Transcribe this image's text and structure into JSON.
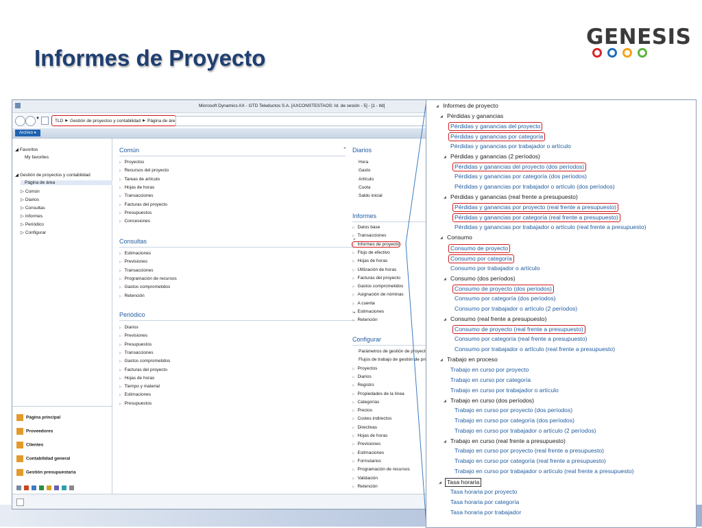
{
  "slide": {
    "title": "Informes de Proyecto",
    "logo_text": "GENESIS",
    "logo_ring_colors": [
      "#d6262b",
      "#1f6fb5",
      "#f3a21a",
      "#5cb33b"
    ]
  },
  "window": {
    "title": "Microsoft Dynamics AX - GTD Teleductos S.A. [AXCONSTESTAOS: Id. de sesión - 5] - [1 - tld]",
    "breadcrumb": [
      "TLD",
      "Gestión de proyectos y contabilidad",
      "Página de área"
    ],
    "archivo_label": "Archivo"
  },
  "left_nav": {
    "favoritos": "Favoritos",
    "my_favorites": "My favorites",
    "module": "Gestión de proyectos y contabilidad",
    "items": [
      "Página de área",
      "Común",
      "Diarios",
      "Consultas",
      "Informes",
      "Periódico",
      "Configurar"
    ],
    "bottom_modules": [
      "Página principal",
      "Proveedores",
      "Clientes",
      "Contabilidad general",
      "Gestión presupuestaria"
    ]
  },
  "groups": {
    "comun": {
      "title": "Común",
      "items": [
        "Proyectos",
        "Recursos del proyecto",
        "Tareas de artículo",
        "Hojas de horas",
        "Transacciones",
        "Facturas del proyecto",
        "Presupuestos",
        "Concesiones"
      ]
    },
    "consultas": {
      "title": "Consultas",
      "items": [
        "Estimaciones",
        "Previsiones",
        "Transacciones",
        "Programación de recursos",
        "Gastos comprometidos",
        "Retención"
      ]
    },
    "periodico": {
      "title": "Periódico",
      "items": [
        "Diarios",
        "Previsiones",
        "Presupuestos",
        "Transacciones",
        "Gastos comprometidos",
        "Facturas del proyecto",
        "Hojas de horas",
        "Tiempo y material",
        "Estimaciones",
        "Presupuestos"
      ]
    },
    "diarios": {
      "title": "Diarios",
      "items": [
        "Hora",
        "Gasto",
        "Artículo",
        "Cuota",
        "Saldo inicial"
      ]
    },
    "informes": {
      "title": "Informes",
      "items": [
        "Datos base",
        "Transacciones",
        "Informes de proyecto",
        "Flujo de efectivo",
        "Hojas de horas",
        "Utilización de horas",
        "Facturas del proyecto",
        "Gastos comprometidos",
        "Asignación de nóminas",
        "A cuenta",
        "Estimaciones",
        "Retención"
      ]
    },
    "configurar": {
      "title": "Configurar",
      "items": [
        "Parámetros de gestión de proyectos y c",
        "Flujos de trabajo de gestión de proyect",
        "Proyectos",
        "Diarios",
        "Registro",
        "Propiedades de la línea",
        "Categorías",
        "Precios",
        "Costes indirectos",
        "Directivas",
        "Hojas de horas",
        "Previsiones",
        "Estimaciones",
        "Formularios",
        "Programación de recursos",
        "Validación",
        "Retención"
      ]
    }
  },
  "tree": {
    "root": "Informes de proyecto",
    "pyg": {
      "title": "Pérdidas y ganancias",
      "items": [
        "Pérdidas y ganancias del proyecto",
        "Pérdidas y ganancias por categoría",
        "Pérdidas y ganancias por trabajador o artículo"
      ],
      "dos": {
        "title": "Pérdidas y ganancias (2 períodos)",
        "items": [
          "Pérdidas y ganancias del proyecto (dos períodos)",
          "Pérdidas y ganancias por categoría (dos períodos)",
          "Pérdidas y ganancias por trabajador o artículo (dos períodos)"
        ]
      },
      "real": {
        "title": "Pérdidas y ganancias (real frente a presupuesto)",
        "items": [
          "Pérdidas y ganancias por proyecto (real frente a presupuesto)",
          "Pérdidas y ganancias por categoría (real frente a presupuesto)",
          "Pérdidas y ganancias por trabajador o artículo (real frente a presupuesto)"
        ]
      }
    },
    "consumo": {
      "title": "Consumo",
      "items": [
        "Consumo de proyecto",
        "Consumo por categoría",
        "Consumo por trabajador o artículo"
      ],
      "dos": {
        "title": "Consumo (dos períodos)",
        "items": [
          "Consumo de proyecto (dos períodos)",
          "Consumo por categoría (dos períodos)",
          "Consumo por trabajador o artículo (2 períodos)"
        ]
      },
      "real": {
        "title": "Consumo (real frente a presupuesto)",
        "items": [
          "Consumo de proyecto (real frente a presupuesto)",
          "Consumo por categoría (real frente a presupuesto)",
          "Consumo por trabajador o artículo (real frente a presupuesto)"
        ]
      }
    },
    "trabajo": {
      "title": "Trabajo en proceso",
      "items": [
        "Trabajo en curso por proyecto",
        "Trabajo en curso por categoría",
        "Trabajo en curso por trabajador o artículo"
      ],
      "dos": {
        "title": "Trabajo en curso (dos períodos)",
        "items": [
          "Trabajo en curso por proyecto (dos períodos)",
          "Trabajo en curso por categoría (dos períodos)",
          "Trabajo en curso por trabajador o artículo (2 períodos)"
        ]
      },
      "real": {
        "title": "Trabajo en curso (real frente a presupuesto)",
        "items": [
          "Trabajo en curso por proyecto (real frente a presupuesto)",
          "Trabajo en curso por categoría (real frente a presupuesto)",
          "Trabajo en curso por trabajador o artículo (real frente a presupuesto)"
        ]
      }
    },
    "tasa": {
      "title": "Tasa horaria",
      "items": [
        "Tasa horaria por proyecto",
        "Tasa horaria por categoría",
        "Tasa horaria por trabajador"
      ]
    }
  }
}
